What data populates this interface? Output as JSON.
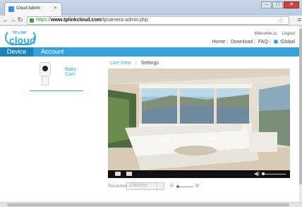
{
  "browser": {
    "tab_title": "Cloud Admin",
    "url_prefix": "https://",
    "url_host": "www.tplinkcloud.com",
    "url_path": "/tpcamera-admin.php"
  },
  "header": {
    "logo_brand": "TP-LINK",
    "logo_text": "cloud",
    "welcome": "Welcome,cc",
    "logout": "Logout",
    "nav": [
      "Home",
      "Download",
      "FAQ",
      "Global"
    ]
  },
  "mainnav": {
    "device": "Device",
    "account": "Account"
  },
  "devices": [
    {
      "name": "Baby Cam"
    }
  ],
  "view_tabs": {
    "live": "Live View",
    "settings": "Settings"
  },
  "controls": {
    "resolution_label": "Resolution:",
    "resolution_value": "1080P(H)"
  },
  "colors": {
    "accent": "#35a7d9",
    "nav_active": "#1f81b8"
  }
}
